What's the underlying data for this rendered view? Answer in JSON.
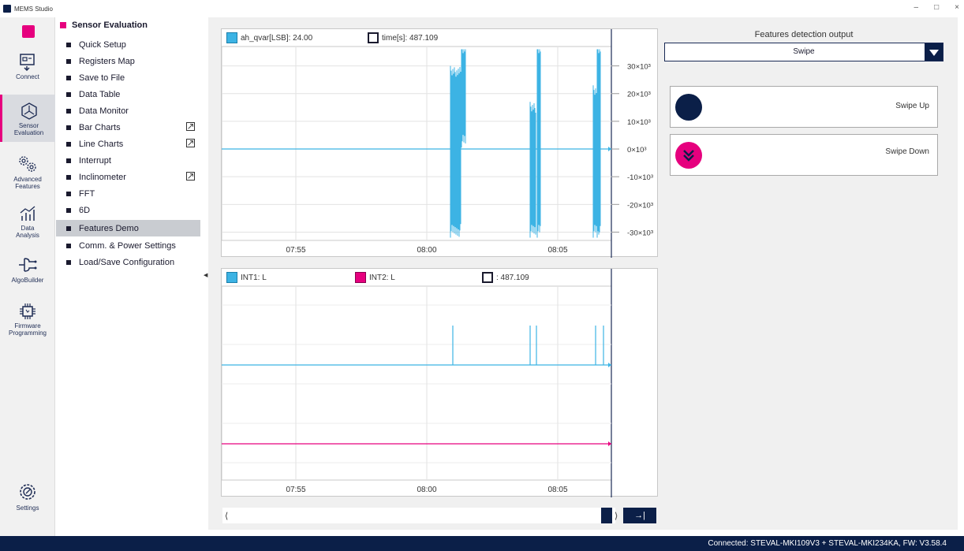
{
  "window": {
    "title": "MEMS Studio",
    "controls": [
      "–",
      "□",
      "×"
    ]
  },
  "rail": {
    "items": [
      {
        "label": "Connect",
        "icon": "connect-icon"
      },
      {
        "label": "Sensor\nEvaluation",
        "icon": "sensor-evaluation-icon",
        "active": true
      },
      {
        "label": "Advanced\nFeatures",
        "icon": "gears-icon"
      },
      {
        "label": "Data\nAnalysis",
        "icon": "data-analysis-icon"
      },
      {
        "label": "AlgoBuilder",
        "icon": "algobuilder-icon"
      },
      {
        "label": "Firmware\nProgramming",
        "icon": "chip-icon"
      }
    ],
    "settings_label": "Settings"
  },
  "nav": {
    "header": "Sensor Evaluation",
    "items": [
      {
        "label": "Quick Setup"
      },
      {
        "label": "Registers Map"
      },
      {
        "label": "Save to File"
      },
      {
        "label": "Data Table"
      },
      {
        "label": "Data Monitor"
      },
      {
        "label": "Bar Charts",
        "external": true
      },
      {
        "label": "Line Charts",
        "external": true
      },
      {
        "label": "Interrupt"
      },
      {
        "label": "Inclinometer",
        "external": true
      },
      {
        "label": "FFT"
      },
      {
        "label": "6D"
      },
      {
        "label": "Features Demo",
        "selected": true
      },
      {
        "label": "Comm. & Power Settings"
      },
      {
        "label": "Load/Save Configuration"
      }
    ]
  },
  "top_plot": {
    "legend": [
      {
        "label": "ah_qvar[LSB]: 24.00",
        "color": "#3cb3e4"
      },
      {
        "label": "time[s]: 487.109",
        "color": "#ffffff"
      }
    ],
    "y_ticks": [
      "30×10³",
      "20×10³",
      "10×10³",
      "0×10³",
      "-10×10³",
      "-20×10³",
      "-30×10³"
    ],
    "x_ticks": [
      "07:55",
      "08:00",
      "08:05"
    ]
  },
  "bottom_plot": {
    "legend": [
      {
        "label": "INT1: L",
        "color": "#3cb3e4"
      },
      {
        "label": "INT2: L",
        "color": "#e6007e"
      },
      {
        "label": ": 487.109",
        "color": "#ffffff"
      }
    ],
    "x_ticks": [
      "07:55",
      "08:00",
      "08:05"
    ]
  },
  "chart_data": [
    {
      "type": "line",
      "series": [
        {
          "name": "ah_qvar[LSB]",
          "color": "#3cb3e4"
        }
      ],
      "y_ticks": [
        "30×10³",
        "20×10³",
        "10×10³",
        "0×10³",
        "-10×10³",
        "-20×10³",
        "-30×10³"
      ],
      "ylim": [
        -33000,
        37000
      ],
      "x_ticks": [
        "07:55",
        "08:00",
        "08:05"
      ],
      "grid": true
    },
    {
      "type": "line",
      "series": [
        {
          "name": "INT1",
          "color": "#3cb3e4"
        },
        {
          "name": "INT2",
          "color": "#e6007e"
        }
      ],
      "x_ticks": [
        "07:55",
        "08:00",
        "08:05"
      ],
      "grid": true
    }
  ],
  "features": {
    "title": "Features detection output",
    "selected": "Swipe",
    "cards": [
      {
        "label": "Swipe Up",
        "circle_color": "#0b1f48",
        "icon": ""
      },
      {
        "label": "Swipe Down",
        "circle_color": "#e6007e",
        "icon": "chevrons-down-icon"
      }
    ]
  },
  "scroll": {
    "end_button": "→|"
  },
  "status": "Connected:  STEVAL-MKI109V3 + STEVAL-MKI234KA, FW: V3.58.4"
}
